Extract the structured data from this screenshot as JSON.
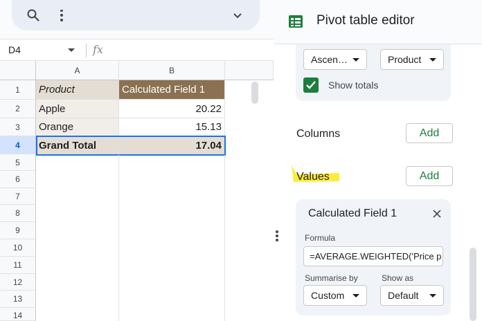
{
  "toolbar": {
    "search_icon": "search-icon",
    "more_icon": "kebab-menu-icon",
    "collapse_icon": "chevron-down-icon"
  },
  "formula_bar": {
    "cell_ref": "D4",
    "fx_label": "fx",
    "content": ""
  },
  "sheet": {
    "columns": [
      "A",
      "B"
    ],
    "rows": [
      "1",
      "2",
      "3",
      "4",
      "5",
      "6",
      "7",
      "8",
      "9",
      "10",
      "11",
      "12",
      "13",
      "14"
    ],
    "selected_row": "4",
    "header": {
      "a": "Product",
      "b": "Calculated Field 1"
    },
    "data": [
      {
        "a": "Apple",
        "b": "20.22"
      },
      {
        "a": "Orange",
        "b": "15.13"
      }
    ],
    "total": {
      "a": "Grand Total",
      "b": "17.04"
    },
    "colors": {
      "header_bg": "#8b7152",
      "row_bg": "#f1ede8",
      "total_bg": "#e4ddd3",
      "selection": "#1a73e8"
    }
  },
  "editor": {
    "title": "Pivot table editor",
    "rows_section": {
      "order_value": "Ascen…",
      "sort_by_value": "Product",
      "show_totals_label": "Show totals",
      "show_totals_checked": true
    },
    "columns_label": "Columns",
    "values_label": "Values",
    "add_label": "Add",
    "value_card": {
      "title": "Calculated Field 1",
      "formula_label": "Formula",
      "formula_value": "=AVERAGE.WEIGHTED('Price p",
      "summarise_label": "Summarise by",
      "summarise_value": "Custom",
      "show_as_label": "Show as",
      "show_as_value": "Default"
    },
    "colors": {
      "accent": "#1e7e3e",
      "highlight": "#ffeb3b",
      "card": "#f0f4f9"
    }
  }
}
